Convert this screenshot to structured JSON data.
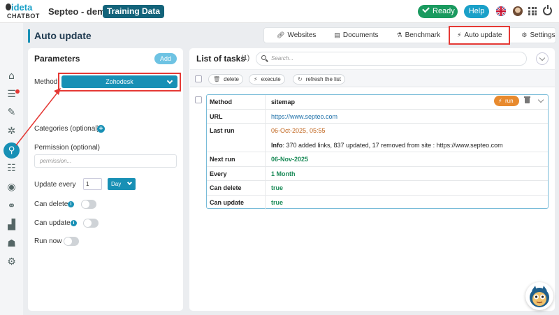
{
  "app": {
    "logo_line1": "ideta",
    "logo_line2": "CHATBOT",
    "project_name": "Septeo - demo",
    "project_badge": "Training Data",
    "status": "Ready",
    "help": "Help"
  },
  "nav": {
    "icons": [
      "home-icon",
      "list-icon",
      "edit-icon",
      "gear-bug-icon",
      "knowledge-icon",
      "form-icon",
      "eye-icon",
      "chat-search-icon",
      "chart-icon",
      "database-icon",
      "settings-icon"
    ],
    "active": "knowledge-icon"
  },
  "page": {
    "title": "Auto update",
    "tabs": [
      "Websites",
      "Documents",
      "Benchmark",
      "Auto update",
      "Settings"
    ],
    "active_tab": "Auto update"
  },
  "parameters": {
    "title": "Parameters",
    "add": "Add",
    "method_label": "Method",
    "method_value": "Zohodesk",
    "categories_label": "Categories (optional)",
    "permission_label": "Permission (optional)",
    "permission_placeholder": "permission...",
    "update_every_label": "Update every",
    "update_every_value": "1",
    "update_every_unit": "Day",
    "can_delete_label": "Can delete",
    "can_delete": false,
    "can_update_label": "Can update",
    "can_update": false,
    "run_now_label": "Run now",
    "run_now": false
  },
  "tasks": {
    "title": "List of tasks",
    "count": "(1)",
    "search_placeholder": "Search...",
    "toolbar": {
      "delete": "delete",
      "execute": "execute",
      "refresh": "refresh the list"
    },
    "items": [
      {
        "method_key": "Method",
        "method": "sitemap",
        "run_label": "run",
        "url_key": "URL",
        "url": "https://www.septeo.com",
        "last_run_key": "Last run",
        "last_run": "06-Oct-2025, 05:55",
        "info_key": "Info",
        "info": ": 370 added links, 837 updated, 17 removed from site : https://www.septeo.com",
        "next_run_key": "Next run",
        "next_run": "06-Nov-2025",
        "every_key": "Every",
        "every": "1 Month",
        "can_delete_key": "Can delete",
        "can_delete": "true",
        "can_update_key": "Can update",
        "can_update": "true"
      }
    ]
  },
  "colors": {
    "primary": "#1890b5",
    "ready": "#1a9a5f",
    "run": "#e88a2e",
    "highlight": "#e53935",
    "link": "#1c6fa8",
    "last_run": "#c0641c",
    "green_value": "#1a8a57"
  }
}
